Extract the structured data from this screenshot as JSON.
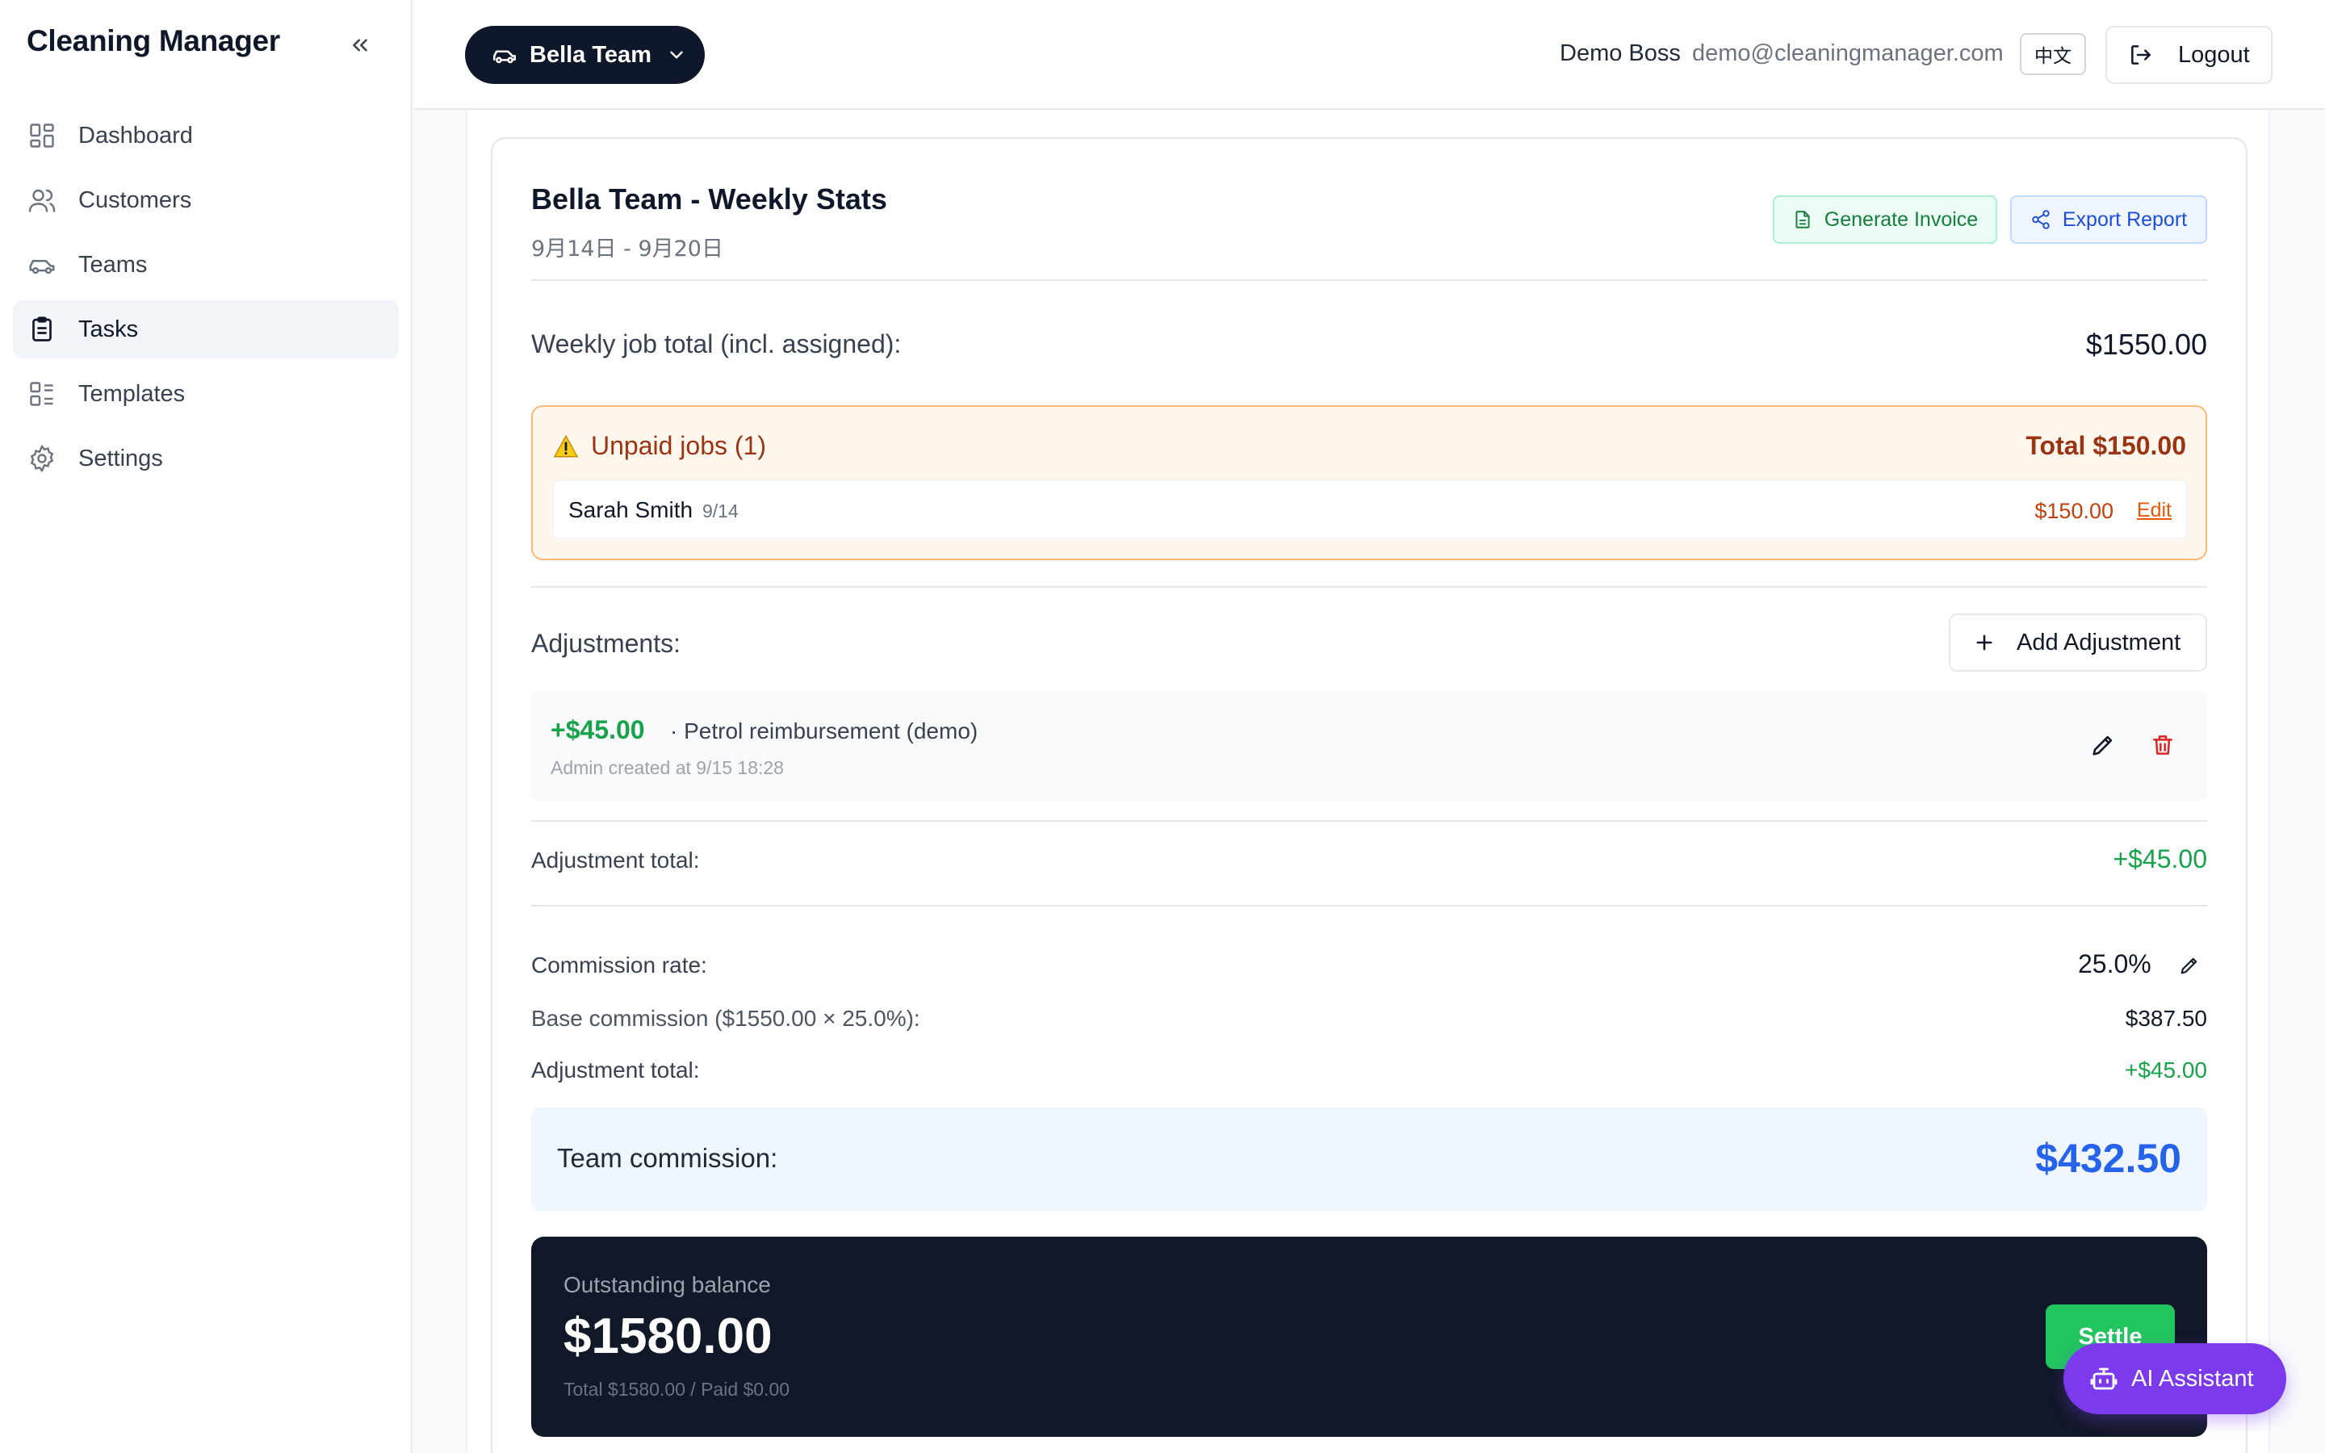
{
  "app": {
    "brand": "Cleaning Manager"
  },
  "sidebar": {
    "items": [
      {
        "label": "Dashboard",
        "icon": "dashboard-icon"
      },
      {
        "label": "Customers",
        "icon": "users-icon"
      },
      {
        "label": "Teams",
        "icon": "car-icon"
      },
      {
        "label": "Tasks",
        "icon": "clipboard-icon",
        "active": true
      },
      {
        "label": "Templates",
        "icon": "list-icon"
      },
      {
        "label": "Settings",
        "icon": "gear-icon"
      }
    ]
  },
  "header": {
    "team_select": "Bella Team",
    "user_name": "Demo Boss",
    "user_email": "demo@cleaningmanager.com",
    "lang_button": "中文",
    "logout": "Logout"
  },
  "stats": {
    "title": "Bella Team - Weekly Stats",
    "date_range": "9月14日 - 9月20日",
    "generate_invoice": "Generate Invoice",
    "export_report": "Export Report",
    "weekly_label": "Weekly job total (incl. assigned):",
    "weekly_value": "$1550.00"
  },
  "unpaid": {
    "title": "Unpaid jobs (1)",
    "total": "Total $150.00",
    "rows": [
      {
        "name": "Sarah Smith",
        "date": "9/14",
        "amount": "$150.00",
        "edit": "Edit"
      }
    ]
  },
  "adjustments": {
    "label": "Adjustments:",
    "add_button": "Add Adjustment",
    "items": [
      {
        "amount": "+$45.00",
        "description": "· Petrol reimbursement (demo)",
        "meta": "Admin created at 9/15 18:28"
      }
    ],
    "total_label": "Adjustment total:",
    "total_value": "+$45.00"
  },
  "commission": {
    "rate_label": "Commission rate:",
    "rate_value": "25.0%",
    "base_label": "Base commission ($1550.00 × 25.0%):",
    "base_value": "$387.50",
    "adj_label": "Adjustment total:",
    "adj_value": "+$45.00",
    "team_label": "Team commission:",
    "team_value": "$432.50"
  },
  "outstanding": {
    "label": "Outstanding balance",
    "value": "$1580.00",
    "meta": "Total $1580.00 / Paid $0.00",
    "settle": "Settle"
  },
  "assistant": {
    "label": "AI Assistant"
  },
  "colors": {
    "primary_dark": "#0f172a",
    "success": "#16a34a",
    "warning": "#9a3412",
    "accent_blue": "#2563eb",
    "assistant": "#7c3aed"
  }
}
